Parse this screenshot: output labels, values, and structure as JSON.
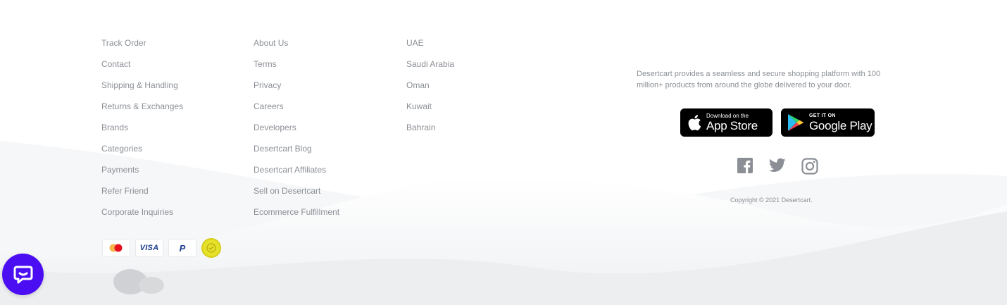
{
  "footer": {
    "col1": [
      "Track Order",
      "Contact",
      "Shipping & Handling",
      "Returns & Exchanges",
      "Brands",
      "Categories",
      "Payments",
      "Refer Friend",
      "Corporate Inquiries"
    ],
    "col2": [
      "About Us",
      "Terms",
      "Privacy",
      "Careers",
      "Developers",
      "Desertcart Blog",
      "Desertcart Affiliates",
      "Sell on Desertcart",
      "Ecommerce Fulfillment"
    ],
    "col3": [
      "UAE",
      "Saudi Arabia",
      "Oman",
      "Kuwait",
      "Bahrain"
    ]
  },
  "payments": {
    "visa": "VISA",
    "paypal": "P",
    "icons": [
      "mastercard-icon",
      "visa-icon",
      "paypal-icon",
      "trust-seal-icon"
    ]
  },
  "description": "Desertcart provides a seamless and secure shopping platform with 100 million+ products from around the globe delivered to your door.",
  "app_store": {
    "small": "Download on the",
    "big": "App Store"
  },
  "google_play": {
    "small": "GET IT ON",
    "big": "Google Play"
  },
  "social": [
    "facebook-icon",
    "twitter-icon",
    "instagram-icon"
  ],
  "copyright": "Copyright © 2021 Desertcart.",
  "colors": {
    "text": "#8b8f95",
    "chat": "#4b0df2",
    "store_bg": "#000000"
  }
}
